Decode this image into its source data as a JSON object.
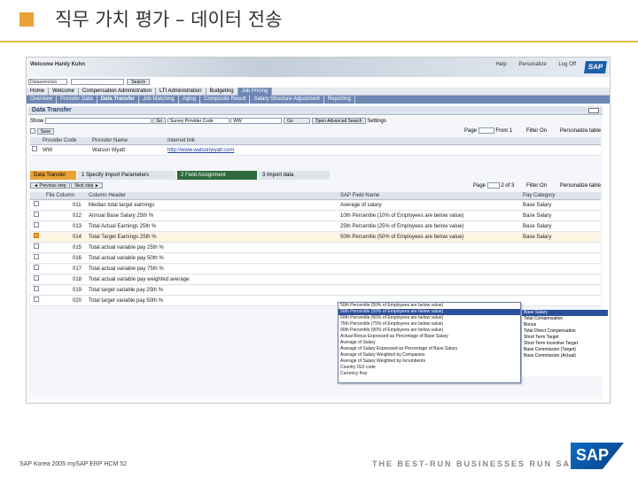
{
  "slide": {
    "title": "직무 가치 평가 – 데이터 전송",
    "footer_left": "SAP Korea 2005 mySAP ERP HCM 52",
    "footer_right": "THE BEST-RUN BUSINESSES RUN SAP",
    "logo_text": "SAP",
    "accent_color": "#e8a236"
  },
  "portal": {
    "welcome": "Welcome Hardy Kuhn",
    "header_links": [
      "Help",
      "Personalize",
      "Log Off"
    ],
    "logo_text": "SAP",
    "search_value": "Dataselection",
    "search_button": "Search",
    "nav_primary": [
      "Home",
      "Welcome",
      "Compensation Administration",
      "LTI Administration",
      "Budgeting",
      "Job Pricing"
    ],
    "nav_primary_active": "Job Pricing",
    "nav_secondary": [
      "Overview",
      "Provider Data",
      "Data Transfer",
      "Job Matching",
      "Aging",
      "Composite Result",
      "Salary Structure Adjustment",
      "Reporting"
    ],
    "nav_secondary_active": "Data Transfer"
  },
  "panel": {
    "title": "Data Transfer",
    "show_label": "Show",
    "go_label": "Go",
    "filter_select": "Survey Provider Code",
    "filter_value": "WW",
    "filter_go": "Go",
    "open_search": "Open Advanced Search",
    "settings": "Settings",
    "save": "Save",
    "page_label": "Page",
    "page_of": "From 1",
    "filter_on": "Filter On",
    "personalize": "Personalize table",
    "provider_headers": [
      "Provider Code",
      "Provider Name",
      "Internet link"
    ],
    "provider_row": {
      "code": "WW",
      "name": "Watson Wyatt",
      "link": "http://www.watsonwyatt.com"
    },
    "roadmap": [
      {
        "num": "1",
        "label": "Data Transfer"
      },
      {
        "num": "1",
        "label": "Specify Import Parameters"
      },
      {
        "num": "2",
        "label": "Field Assignment"
      },
      {
        "num": "3",
        "label": "Import data"
      }
    ],
    "prev_step": "Previous step",
    "next_step": "Next step",
    "page2_label": "Page",
    "page2_of": "2 of 3",
    "filter2_on": "Filter On",
    "personalize2": "Personalize table",
    "table_headers": [
      "File Column",
      "Column Header",
      "SAP Field Name",
      "Pay Category"
    ],
    "rows": [
      {
        "col": "011",
        "header": "Median total target earnings",
        "sap": "Average of salary",
        "pay": "Base Salary"
      },
      {
        "col": "012",
        "header": "Annual Base Salary 25th %",
        "sap": "10th Percentile (10% of Employees are below value)",
        "pay": "Base Salary"
      },
      {
        "col": "013",
        "header": "Total Actual Earnings 25th %",
        "sap": "25th Percentile (25% of Employees are below value)",
        "pay": "Base Salary"
      },
      {
        "col": "014",
        "header": "Total Target Earnings 25th %",
        "sap": "50th Percentile (50% of Employees are below value)",
        "pay": "Base Salary"
      },
      {
        "col": "015",
        "header": "Total actual variable pay 25th %",
        "sap": "",
        "pay": ""
      },
      {
        "col": "016",
        "header": "Total actual variable pay 50th %",
        "sap": "",
        "pay": ""
      },
      {
        "col": "017",
        "header": "Total actual variable pay 75th %",
        "sap": "",
        "pay": ""
      },
      {
        "col": "018",
        "header": "Total actual variable pay weighted average",
        "sap": "",
        "pay": ""
      },
      {
        "col": "019",
        "header": "Total target variable pay 25th %",
        "sap": "",
        "pay": ""
      },
      {
        "col": "020",
        "header": "Total target variable pay 50th %",
        "sap": "",
        "pay": ""
      }
    ],
    "dropdown_options": [
      "50th Percentile (50% of Employees are below value)",
      "50th Percentile (50% of Employees are below value)",
      "60th Percentile (60% of Employees are below value)",
      "75th Percentile (75% of Employees are below value)",
      "90th Percentile (90% of Employees are below value)",
      "Actual Bonus Expressed as Percentage of Base Salary",
      "Average of Salary",
      "Average of Salary Expressed as Percentage of Base Salary",
      "Average of Salary Weighted by Companies",
      "Average of Salary Weighted by Incumbents",
      "Country ISO code",
      "Currency Key"
    ],
    "paycat_options": [
      "Base Salary",
      "Total Compensation",
      "Bonus",
      "Total Direct Compensation",
      "Short Term Target",
      "Short Term Incentive Target",
      "Base Commission (Target)",
      "Base Commission (Actual)"
    ]
  }
}
